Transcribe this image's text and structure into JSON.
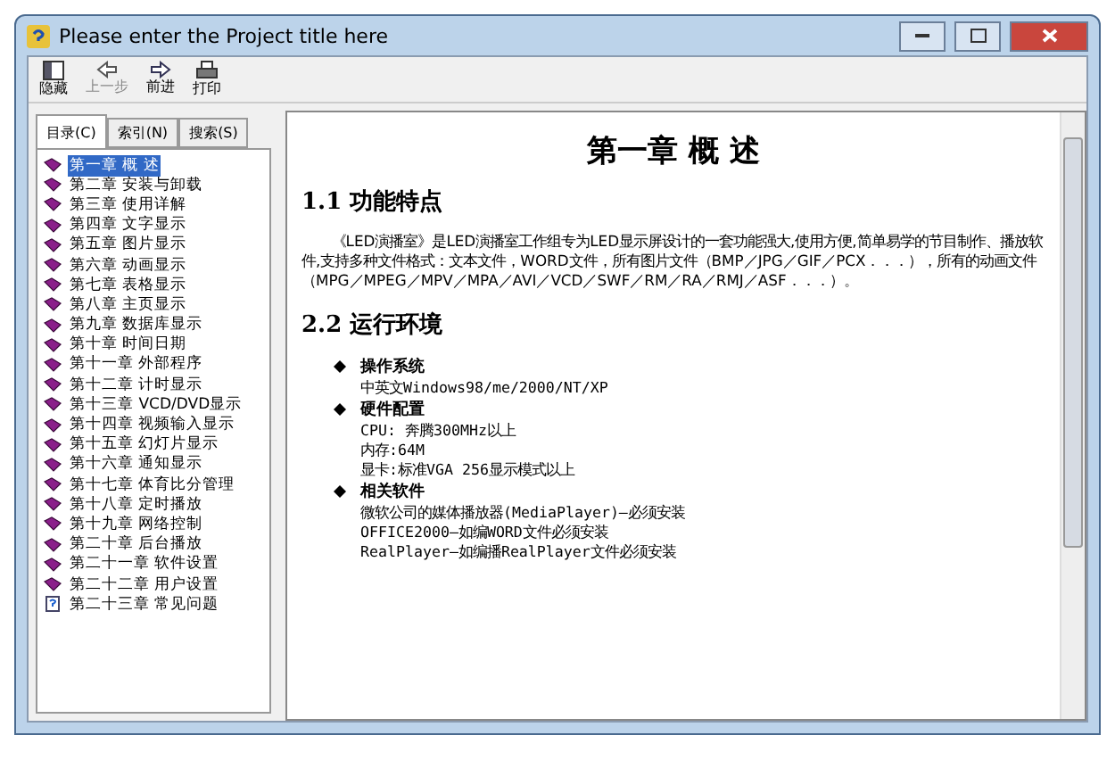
{
  "window": {
    "title": "Please enter the Project title here"
  },
  "toolbar": [
    {
      "label": "隐藏",
      "kind": "hide"
    },
    {
      "label": "上一步",
      "kind": "back",
      "disabled": true
    },
    {
      "label": "前进",
      "kind": "forward",
      "disabled": false
    },
    {
      "label": "打印",
      "kind": "print"
    }
  ],
  "tabs": [
    {
      "label": "目录(C)",
      "selected": true
    },
    {
      "label": "索引(N)",
      "selected": false
    },
    {
      "label": "搜索(S)",
      "selected": false
    }
  ],
  "tree": [
    {
      "label": "第一章 概 述",
      "kind": "book",
      "selected": true
    },
    {
      "label": "第二章 安装与卸载",
      "kind": "book",
      "selected": false
    },
    {
      "label": "第三章 使用详解",
      "kind": "book",
      "selected": false
    },
    {
      "label": "第四章 文字显示",
      "kind": "book",
      "selected": false
    },
    {
      "label": "第五章 图片显示",
      "kind": "book",
      "selected": false
    },
    {
      "label": "第六章 动画显示",
      "kind": "book",
      "selected": false
    },
    {
      "label": "第七章 表格显示",
      "kind": "book",
      "selected": false
    },
    {
      "label": "第八章 主页显示",
      "kind": "book",
      "selected": false
    },
    {
      "label": "第九章 数据库显示",
      "kind": "book",
      "selected": false
    },
    {
      "label": "第十章 时间日期",
      "kind": "book",
      "selected": false
    },
    {
      "label": "第十一章 外部程序",
      "kind": "book",
      "selected": false
    },
    {
      "label": "第十二章 计时显示",
      "kind": "book",
      "selected": false
    },
    {
      "label": "第十三章 VCD/DVD显示",
      "kind": "book",
      "selected": false
    },
    {
      "label": "第十四章 视频输入显示",
      "kind": "book",
      "selected": false
    },
    {
      "label": "第十五章 幻灯片显示",
      "kind": "book",
      "selected": false
    },
    {
      "label": "第十六章 通知显示",
      "kind": "book",
      "selected": false
    },
    {
      "label": "第十七章 体育比分管理",
      "kind": "book",
      "selected": false
    },
    {
      "label": "第十八章 定时播放",
      "kind": "book",
      "selected": false
    },
    {
      "label": "第十九章 网络控制",
      "kind": "book",
      "selected": false
    },
    {
      "label": "第二十章 后台播放",
      "kind": "book",
      "selected": false
    },
    {
      "label": "第二十一章 软件设置",
      "kind": "book",
      "selected": false
    },
    {
      "label": "第二十二章 用户设置",
      "kind": "book",
      "selected": false
    },
    {
      "label": "第二十三章 常见问题",
      "kind": "help",
      "selected": false
    }
  ],
  "document": {
    "title": "第一章 概 述",
    "sections": [
      {
        "heading": "1.1 功能特点",
        "paragraph": "《LED演播室》是LED演播室工作组专为LED显示屏设计的一套功能强大,使用方便,简单易学的节目制作、播放软件,支持多种文件格式：文本文件，WORD文件，所有图片文件（BMP／JPG／GIF／PCX．．．），所有的动画文件（MPG／MPEG／MPV／MPA／AVI／VCD／SWF／RM／RA／RMJ／ASF．．．）。"
      },
      {
        "heading": "2.2 运行环境",
        "bullets": [
          {
            "title": "操作系统",
            "lines": [
              "中英文Windows98/me/2000/NT/XP"
            ]
          },
          {
            "title": "硬件配置",
            "lines": [
              "CPU: 奔腾300MHz以上",
              "内存:64M",
              "显卡:标准VGA 256显示模式以上"
            ]
          },
          {
            "title": "相关软件",
            "lines": [
              "微软公司的媒体播放器(MediaPlayer)—必须安装",
              "OFFICE2000—如编WORD文件必须安装",
              "RealPlayer—如编播RealPlayer文件必须安装"
            ]
          }
        ]
      }
    ]
  }
}
